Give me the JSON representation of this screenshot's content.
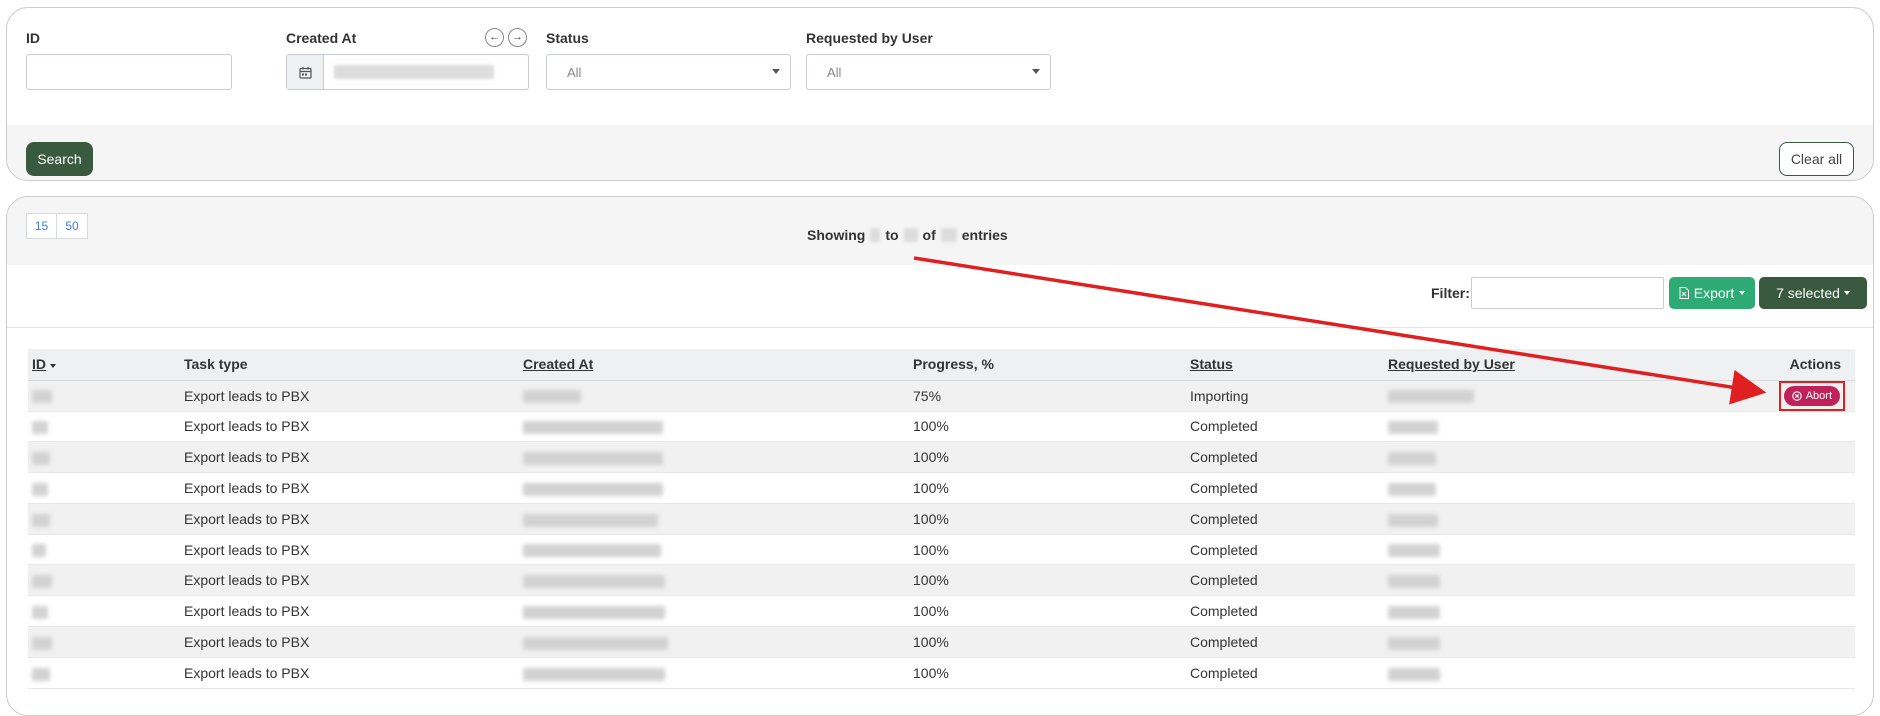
{
  "filters": {
    "id": {
      "label": "ID",
      "value": ""
    },
    "created_at": {
      "label": "Created At",
      "prev_icon": "arrow-left-icon",
      "next_icon": "arrow-right-icon",
      "calendar_icon": "calendar-icon"
    },
    "status": {
      "label": "Status",
      "selected": "All"
    },
    "requested_by": {
      "label": "Requested by User",
      "selected": "All"
    },
    "search_label": "Search",
    "clear_label": "Clear all"
  },
  "results": {
    "page_sizes": [
      "15",
      "50"
    ],
    "showing": {
      "prefix": "Showing",
      "to": "to",
      "of": "of",
      "suffix": "entries"
    },
    "filter_label": "Filter:",
    "export_label": "Export",
    "selected_label": "7 selected",
    "columns": {
      "id": "ID",
      "task_type": "Task type",
      "created_at": "Created At",
      "progress": "Progress, %",
      "status": "Status",
      "requested_by": "Requested by User",
      "actions": "Actions"
    },
    "abort_label": "Abort",
    "rows": [
      {
        "task_type": "Export leads to PBX",
        "progress": "75%",
        "status": "Importing",
        "has_abort": true
      },
      {
        "task_type": "Export leads to PBX",
        "progress": "100%",
        "status": "Completed",
        "has_abort": false
      },
      {
        "task_type": "Export leads to PBX",
        "progress": "100%",
        "status": "Completed",
        "has_abort": false
      },
      {
        "task_type": "Export leads to PBX",
        "progress": "100%",
        "status": "Completed",
        "has_abort": false
      },
      {
        "task_type": "Export leads to PBX",
        "progress": "100%",
        "status": "Completed",
        "has_abort": false
      },
      {
        "task_type": "Export leads to PBX",
        "progress": "100%",
        "status": "Completed",
        "has_abort": false
      },
      {
        "task_type": "Export leads to PBX",
        "progress": "100%",
        "status": "Completed",
        "has_abort": false
      },
      {
        "task_type": "Export leads to PBX",
        "progress": "100%",
        "status": "Completed",
        "has_abort": false
      },
      {
        "task_type": "Export leads to PBX",
        "progress": "100%",
        "status": "Completed",
        "has_abort": false
      },
      {
        "task_type": "Export leads to PBX",
        "progress": "100%",
        "status": "Completed",
        "has_abort": false
      }
    ]
  },
  "colors": {
    "primary_dark_green": "#3a5a40",
    "export_green": "#2eaa75",
    "abort_pink": "#c0215a",
    "annotation_red": "#e02020"
  }
}
